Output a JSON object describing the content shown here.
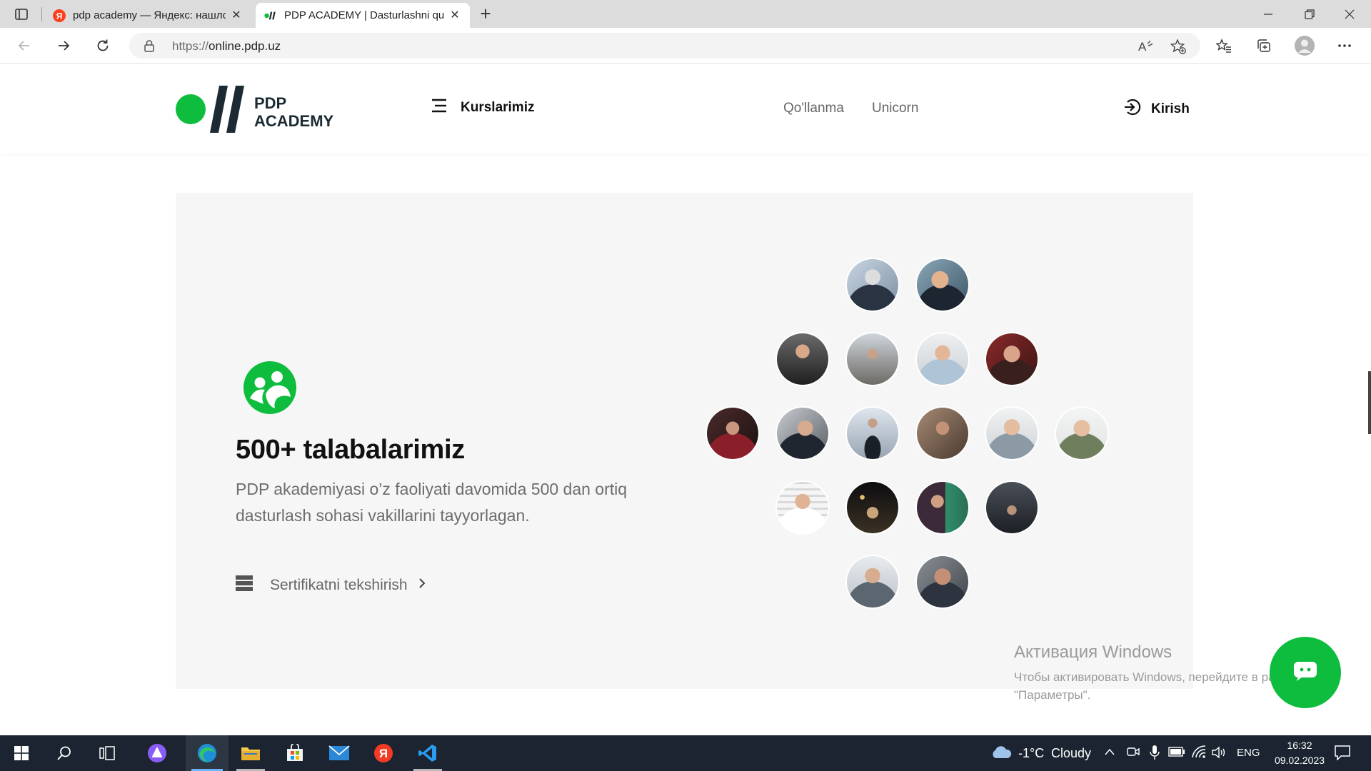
{
  "browser": {
    "tabs": [
      {
        "title": "pdp academy — Яндекс: нашлось",
        "active": false,
        "favicon": "yandex-favicon"
      },
      {
        "title": "PDP ACADEMY | Dasturlashni qulay",
        "active": true,
        "favicon": "pdp-favicon"
      }
    ],
    "url_scheme": "https://",
    "url_host": "online.pdp.uz",
    "icons": [
      "sidebar-toggle-icon",
      "back-icon",
      "forward-icon",
      "refresh-icon",
      "lock-icon",
      "read-aloud-icon",
      "add-favorite-icon",
      "favorites-icon",
      "collections-icon",
      "profile-icon",
      "more-icon",
      "minimize-icon",
      "restore-icon",
      "close-icon"
    ]
  },
  "header": {
    "logo_line1": "PDP",
    "logo_line2": "ACADEMY",
    "courses_label": "Kurslarimiz",
    "nav": [
      "Qo'llanma",
      "Unicorn"
    ],
    "login_label": "Kirish"
  },
  "hero": {
    "title": "500+ talabalarimiz",
    "description": "PDP akademiyasi o’z faoliyati davomida 500 dan ortiq dasturlash sohasi vakillarini tayyorlagan.",
    "certificate_link": "Sertifikatni tekshirish",
    "student_avatar_count": 20
  },
  "overlays": {
    "activation_title": "Активация Windows",
    "activation_line1": "Чтобы активировать Windows, перейдите в раздел",
    "activation_line2": "\"Параметры\"."
  },
  "taskbar": {
    "weather_temp": "-1°C",
    "weather_text": "Cloudy",
    "language": "ENG",
    "time": "16:32",
    "date": "09.02.2023",
    "apps": [
      "start-icon",
      "search-icon",
      "task-view-icon",
      "alice-icon",
      "edge-icon",
      "file-explorer-icon",
      "store-icon",
      "mail-icon",
      "yandex-browser-icon",
      "vscode-icon"
    ]
  },
  "colors": {
    "brand_green": "#0ebd3d",
    "brand_dark": "#1b2a33",
    "card_bg": "#f6f6f6"
  }
}
